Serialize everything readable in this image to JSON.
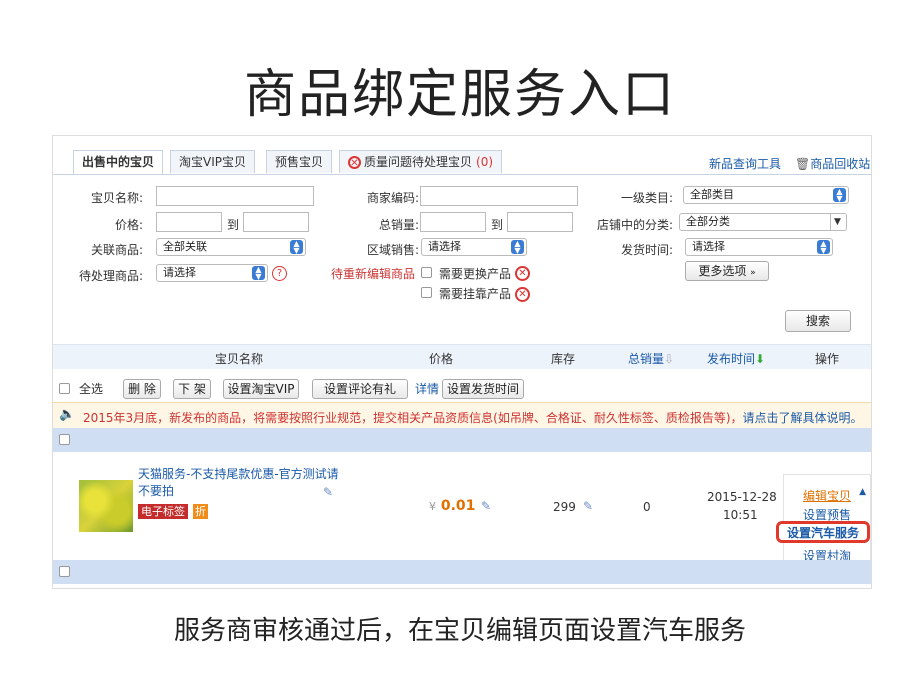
{
  "slide": {
    "title": "商品绑定服务入口",
    "caption": "服务商审核通过后，在宝贝编辑页面设置汽车服务"
  },
  "tabs": [
    {
      "label": "出售中的宝贝",
      "active": true
    },
    {
      "label": "淘宝VIP宝贝"
    },
    {
      "label": "预售宝贝"
    },
    {
      "label": "质量问题待处理宝贝",
      "count": "(0)"
    }
  ],
  "top_links": {
    "new_query": "新品查询工具",
    "recycle": "商品回收站"
  },
  "filters": {
    "name_label": "宝贝名称:",
    "merchant_code_label": "商家编码:",
    "category_label": "一级类目:",
    "category_value": "全部类目",
    "price_label": "价格:",
    "to": "到",
    "total_sales_label": "总销量:",
    "store_category_label": "店铺中的分类:",
    "store_category_value": "全部分类",
    "related_label": "关联商品:",
    "related_value": "全部关联",
    "region_label": "区域销售:",
    "region_value": "请选择",
    "ship_time_label": "发货时间:",
    "ship_time_value": "请选择",
    "pending_label": "待处理商品:",
    "pending_value": "请选择",
    "reedit_label": "待重新编辑商品",
    "need_replace": "需要更换产品",
    "need_attach": "需要挂靠产品",
    "more_options": "更多选项",
    "search": "搜索"
  },
  "table_header": {
    "name": "宝贝名称",
    "price": "价格",
    "stock": "库存",
    "total_sales": "总销量",
    "publish_time": "发布时间",
    "ops": "操作"
  },
  "bulk": {
    "select_all": "全选",
    "delete": "删 除",
    "offshelf": "下 架",
    "set_vip": "设置淘宝VIP",
    "set_review": "设置评论有礼",
    "details": "详情",
    "set_ship_time": "设置发货时间"
  },
  "notice": {
    "text": "2015年3月底，新发布的商品，将需要按照行业规范，提交相关产品资质信息(如吊牌、合格证、耐久性标签、质检报告等)，",
    "link": "请点击了解具体说明。"
  },
  "product": {
    "title": "天猫服务-不支持尾款优惠-官方测试请不要拍",
    "tag_e_label": "电子标签",
    "tag_discount": "折",
    "currency": "¥",
    "price": "0.01",
    "stock": "299",
    "sales": "0",
    "publish_date": "2015-12-28",
    "publish_time": "10:51"
  },
  "ops_menu": {
    "edit": "编辑宝贝",
    "set_presale": "设置预售",
    "set_car_service": "设置汽车服务",
    "set_village": "设置村淘"
  },
  "colors": {
    "link": "#1a5aa8",
    "highlight": "#e0392b",
    "price": "#e07000",
    "header_bg": "#edf3fa",
    "row_bar": "#cfdef3"
  }
}
